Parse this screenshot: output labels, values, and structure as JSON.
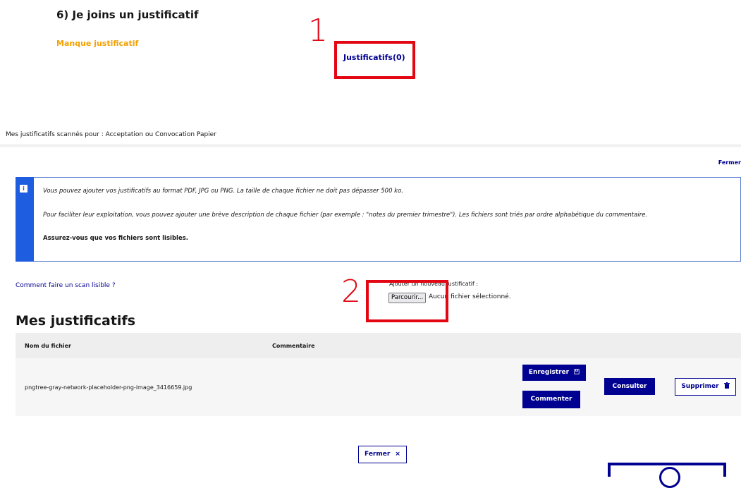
{
  "step": {
    "title": "6) Je joins un justificatif",
    "status": "Manque justificatif",
    "justificatifs_link": "Justificatifs(0)"
  },
  "annotations": {
    "marker_1": "1",
    "marker_2": "2",
    "color": "#e30613"
  },
  "modal": {
    "caption": "Mes justificatifs scannés pour : Acceptation ou Convocation Papier",
    "close_top": "Fermer",
    "info_icon": "i",
    "info_lines": [
      "Vous pouvez ajouter vos justificatifs au format PDF, JPG ou PNG. La taille de chaque fichier ne doit pas dépasser 500 ko.",
      "Pour faciliter leur exploitation, vous pouvez ajouter une brève description de chaque fichier (par exemple : \"notes du premier trimestre\"). Les fichiers sont triés par ordre alphabétique du commentaire.",
      "Assurez-vous que vos fichiers sont lisibles."
    ],
    "scan_help_link": "Comment faire un scan lisible ?",
    "add_label": "Ajouter un nouveau justificatif :",
    "browse_button": "Parcourir...",
    "no_file": "Aucun fichier sélectionné.",
    "section_title": "Mes justificatifs",
    "table": {
      "headers": [
        "Nom du fichier",
        "Commentaire"
      ],
      "rows": [
        {
          "filename": "pngtree-gray-network-placeholder-png-image_3416659.jpg",
          "comment": ""
        }
      ]
    },
    "buttons": {
      "save": "Enregistrer",
      "save_icon": "save-icon",
      "comment": "Commenter",
      "view": "Consulter",
      "delete": "Supprimer",
      "delete_icon": "trash-icon",
      "close": "Fermer",
      "close_icon": "×"
    }
  },
  "colors": {
    "primary": "#000091",
    "warning": "#f5a000",
    "info": "#1f5de0"
  }
}
